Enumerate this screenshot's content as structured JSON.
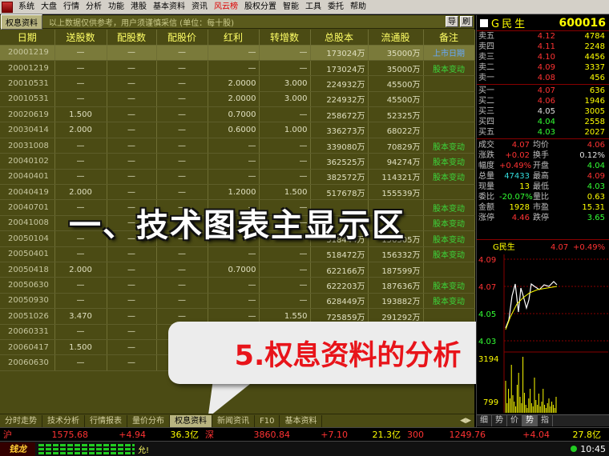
{
  "menu": [
    "系统",
    "大盘",
    "行情",
    "分析",
    "功能",
    "港股",
    "基本资料",
    "资讯",
    "风云榜",
    "股权分置",
    "智能",
    "工具",
    "委托",
    "帮助"
  ],
  "menu_hot_index": 8,
  "panel": {
    "title": "权息资料",
    "note": "以上数据仅供参考，用户须谨慎采信 (单位：每十股)",
    "btn1": "导",
    "btn2": "刷"
  },
  "columns": [
    "日期",
    "送股数",
    "配股数",
    "配股价",
    "红利",
    "转增数",
    "总股本",
    "流通股",
    "备注"
  ],
  "rows": [
    [
      "20001219",
      "—",
      "—",
      "—",
      "—",
      "—",
      "173024万",
      "35000万",
      "上市日期"
    ],
    [
      "20001219",
      "—",
      "—",
      "—",
      "—",
      "—",
      "173024万",
      "35000万",
      "股本变动"
    ],
    [
      "20010531",
      "—",
      "—",
      "—",
      "2.0000",
      "3.000",
      "224932万",
      "45500万",
      ""
    ],
    [
      "20010531",
      "—",
      "—",
      "—",
      "2.0000",
      "3.000",
      "224932万",
      "45500万",
      ""
    ],
    [
      "20020619",
      "1.500",
      "—",
      "—",
      "0.7000",
      "—",
      "258672万",
      "52325万",
      ""
    ],
    [
      "20030414",
      "2.000",
      "—",
      "—",
      "0.6000",
      "1.000",
      "336273万",
      "68022万",
      ""
    ],
    [
      "20031008",
      "—",
      "—",
      "—",
      "—",
      "—",
      "339080万",
      "70829万",
      "股本变动"
    ],
    [
      "20040102",
      "—",
      "—",
      "—",
      "—",
      "—",
      "362525万",
      "94274万",
      "股本变动"
    ],
    [
      "20040401",
      "—",
      "—",
      "—",
      "—",
      "—",
      "382572万",
      "114321万",
      "股本变动"
    ],
    [
      "20040419",
      "2.000",
      "—",
      "—",
      "1.2000",
      "1.500",
      "517678万",
      "155539万",
      ""
    ],
    [
      "20040701",
      "—",
      "—",
      "—",
      "—",
      "—",
      "",
      "",
      "股本变动"
    ],
    [
      "20041008",
      "—",
      "—",
      "—",
      "—",
      "—",
      "",
      "",
      "股本变动"
    ],
    [
      "20050104",
      "—",
      "—",
      "—",
      "—",
      "—",
      "518444万",
      "156305万",
      "股本变动"
    ],
    [
      "20050401",
      "—",
      "—",
      "—",
      "—",
      "—",
      "518472万",
      "156332万",
      "股本变动"
    ],
    [
      "20050418",
      "2.000",
      "—",
      "—",
      "0.7000",
      "—",
      "622166万",
      "187599万",
      ""
    ],
    [
      "20050630",
      "—",
      "—",
      "—",
      "—",
      "—",
      "622203万",
      "187636万",
      "股本变动"
    ],
    [
      "20050930",
      "—",
      "—",
      "—",
      "—",
      "—",
      "628449万",
      "193882万",
      "股本变动"
    ],
    [
      "20051026",
      "3.470",
      "—",
      "—",
      "—",
      "1.550",
      "725859万",
      "291292万",
      ""
    ],
    [
      "20060331",
      "—",
      "—",
      "—",
      "—",
      "—",
      "726119万",
      "291552万",
      ""
    ],
    [
      "20060417",
      "1.500",
      "—",
      "—",
      "—",
      "—",
      "",
      "",
      ""
    ],
    [
      "20060630",
      "—",
      "—",
      "—",
      "—",
      "—",
      "",
      "",
      ""
    ]
  ],
  "overlay1": "一、技术图表主显示区",
  "overlay2": "5.权息资料的分析",
  "tabs": [
    "分时走势",
    "技术分析",
    "行情报表",
    "量价分布",
    "权息资料",
    "新闻资讯",
    "F10",
    "基本资料"
  ],
  "active_tab": 4,
  "stock": {
    "name": "G民生",
    "code": "600016"
  },
  "sells": [
    [
      "卖五",
      "4.12",
      "4784"
    ],
    [
      "卖四",
      "4.11",
      "2248"
    ],
    [
      "卖三",
      "4.10",
      "4456"
    ],
    [
      "卖二",
      "4.09",
      "3337"
    ],
    [
      "卖一",
      "4.08",
      "456"
    ]
  ],
  "buys": [
    [
      "买一",
      "4.07",
      "636"
    ],
    [
      "买二",
      "4.06",
      "1946"
    ],
    [
      "买三",
      "4.05",
      "3005"
    ],
    [
      "买四",
      "4.04",
      "2558"
    ],
    [
      "买五",
      "4.03",
      "2027"
    ]
  ],
  "buy_colors": [
    "red",
    "red",
    "white",
    "green",
    "green"
  ],
  "stats": [
    [
      "成交",
      "4.07",
      "均价",
      "4.06"
    ],
    [
      "涨跌",
      "+0.02",
      "换手",
      "0.12%"
    ],
    [
      "幅度",
      "+0.49%",
      "开盘",
      "4.04"
    ],
    [
      "总量",
      "47433",
      "最高",
      "4.09"
    ],
    [
      "现量",
      "13",
      "最低",
      "4.03"
    ],
    [
      "委比",
      "-20.07%",
      "量比",
      "0.63"
    ],
    [
      "金额",
      "1928",
      "市盈",
      "15.31"
    ],
    [
      "涨停",
      "4.46",
      "跌停",
      "3.65"
    ]
  ],
  "chart": {
    "header": "G民生",
    "price": "4.07",
    "pct": "+0.49%",
    "ylabels": [
      "4.09",
      "4.07",
      "4.05",
      "4.03"
    ],
    "vollabels": [
      "3194",
      "799"
    ]
  },
  "chart_tabs": [
    "细",
    "势",
    "价",
    "势",
    "指"
  ],
  "status": {
    "sh_label": "沪",
    "sh_idx": "1575.68",
    "sh_chg": "+4.94",
    "sh_amt": "36.3亿",
    "sz_label": "深",
    "sz_idx": "3860.84",
    "sz_chg": "+7.10",
    "sz_amt": "21.3亿",
    "t300_label": "300",
    "t300_idx": "1249.76",
    "t300_chg": "+4.04",
    "t300_amt": "27.8亿"
  },
  "bottom": {
    "logo": "钱龙",
    "ticker": "允!",
    "time": "10:45"
  },
  "colors": {
    "panel_bg": "#4b4b14",
    "header_text": "#ffff66",
    "note_text": "#3cd63c",
    "callout_text": "#e8141a"
  }
}
